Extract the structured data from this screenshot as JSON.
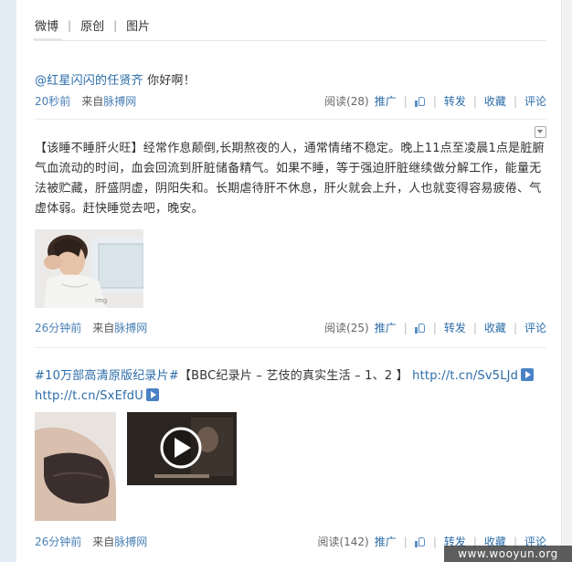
{
  "tabs": [
    "微博",
    "原创",
    "图片"
  ],
  "posts": [
    {
      "mention": "@红星闪闪的任贤齐",
      "text": " 你好啊！",
      "time": "20秒前",
      "from": "来自",
      "source": "脉搏网",
      "read": "阅读(28)",
      "promote": "推广",
      "forward": "转发",
      "favorite": "收藏",
      "comment": "评论"
    },
    {
      "text": "【该睡不睡肝火旺】经常作息颠倒,长期熬夜的人，通常情绪不稳定。晚上11点至凌晨1点是脏腑气血流动的时间，血会回流到肝脏储备精气。如果不睡，等于强迫肝脏继续做分解工作，能量无法被贮藏，肝盛阴虚，阴阳失和。长期虐待肝不休息，肝火就会上升，人也就变得容易疲倦、气虚体弱。赶快睡觉去吧，晚安。",
      "image_caption": "tired woman at laptop",
      "time": "26分钟前",
      "from": "来自",
      "source": "脉搏网",
      "read": "阅读(25)",
      "promote": "推广",
      "forward": "转发",
      "favorite": "收藏",
      "comment": "评论"
    },
    {
      "hashtag": "#10万部高清原版纪录片#",
      "text": "【BBC纪录片 – 艺伎的真实生活 – 1、2 】",
      "link1": "http://t.cn/Sv5LJd",
      "link2": "http://t.cn/SxEfdU",
      "time": "26分钟前",
      "from": "来自",
      "source": "脉搏网",
      "read": "阅读(142)",
      "promote": "推广",
      "forward": "转发",
      "favorite": "收藏",
      "comment": "评论"
    }
  ],
  "watermark": "www.wooyun.org",
  "colors": {
    "link": "#2b6ca8",
    "sidebar": "#e3ecf5"
  }
}
